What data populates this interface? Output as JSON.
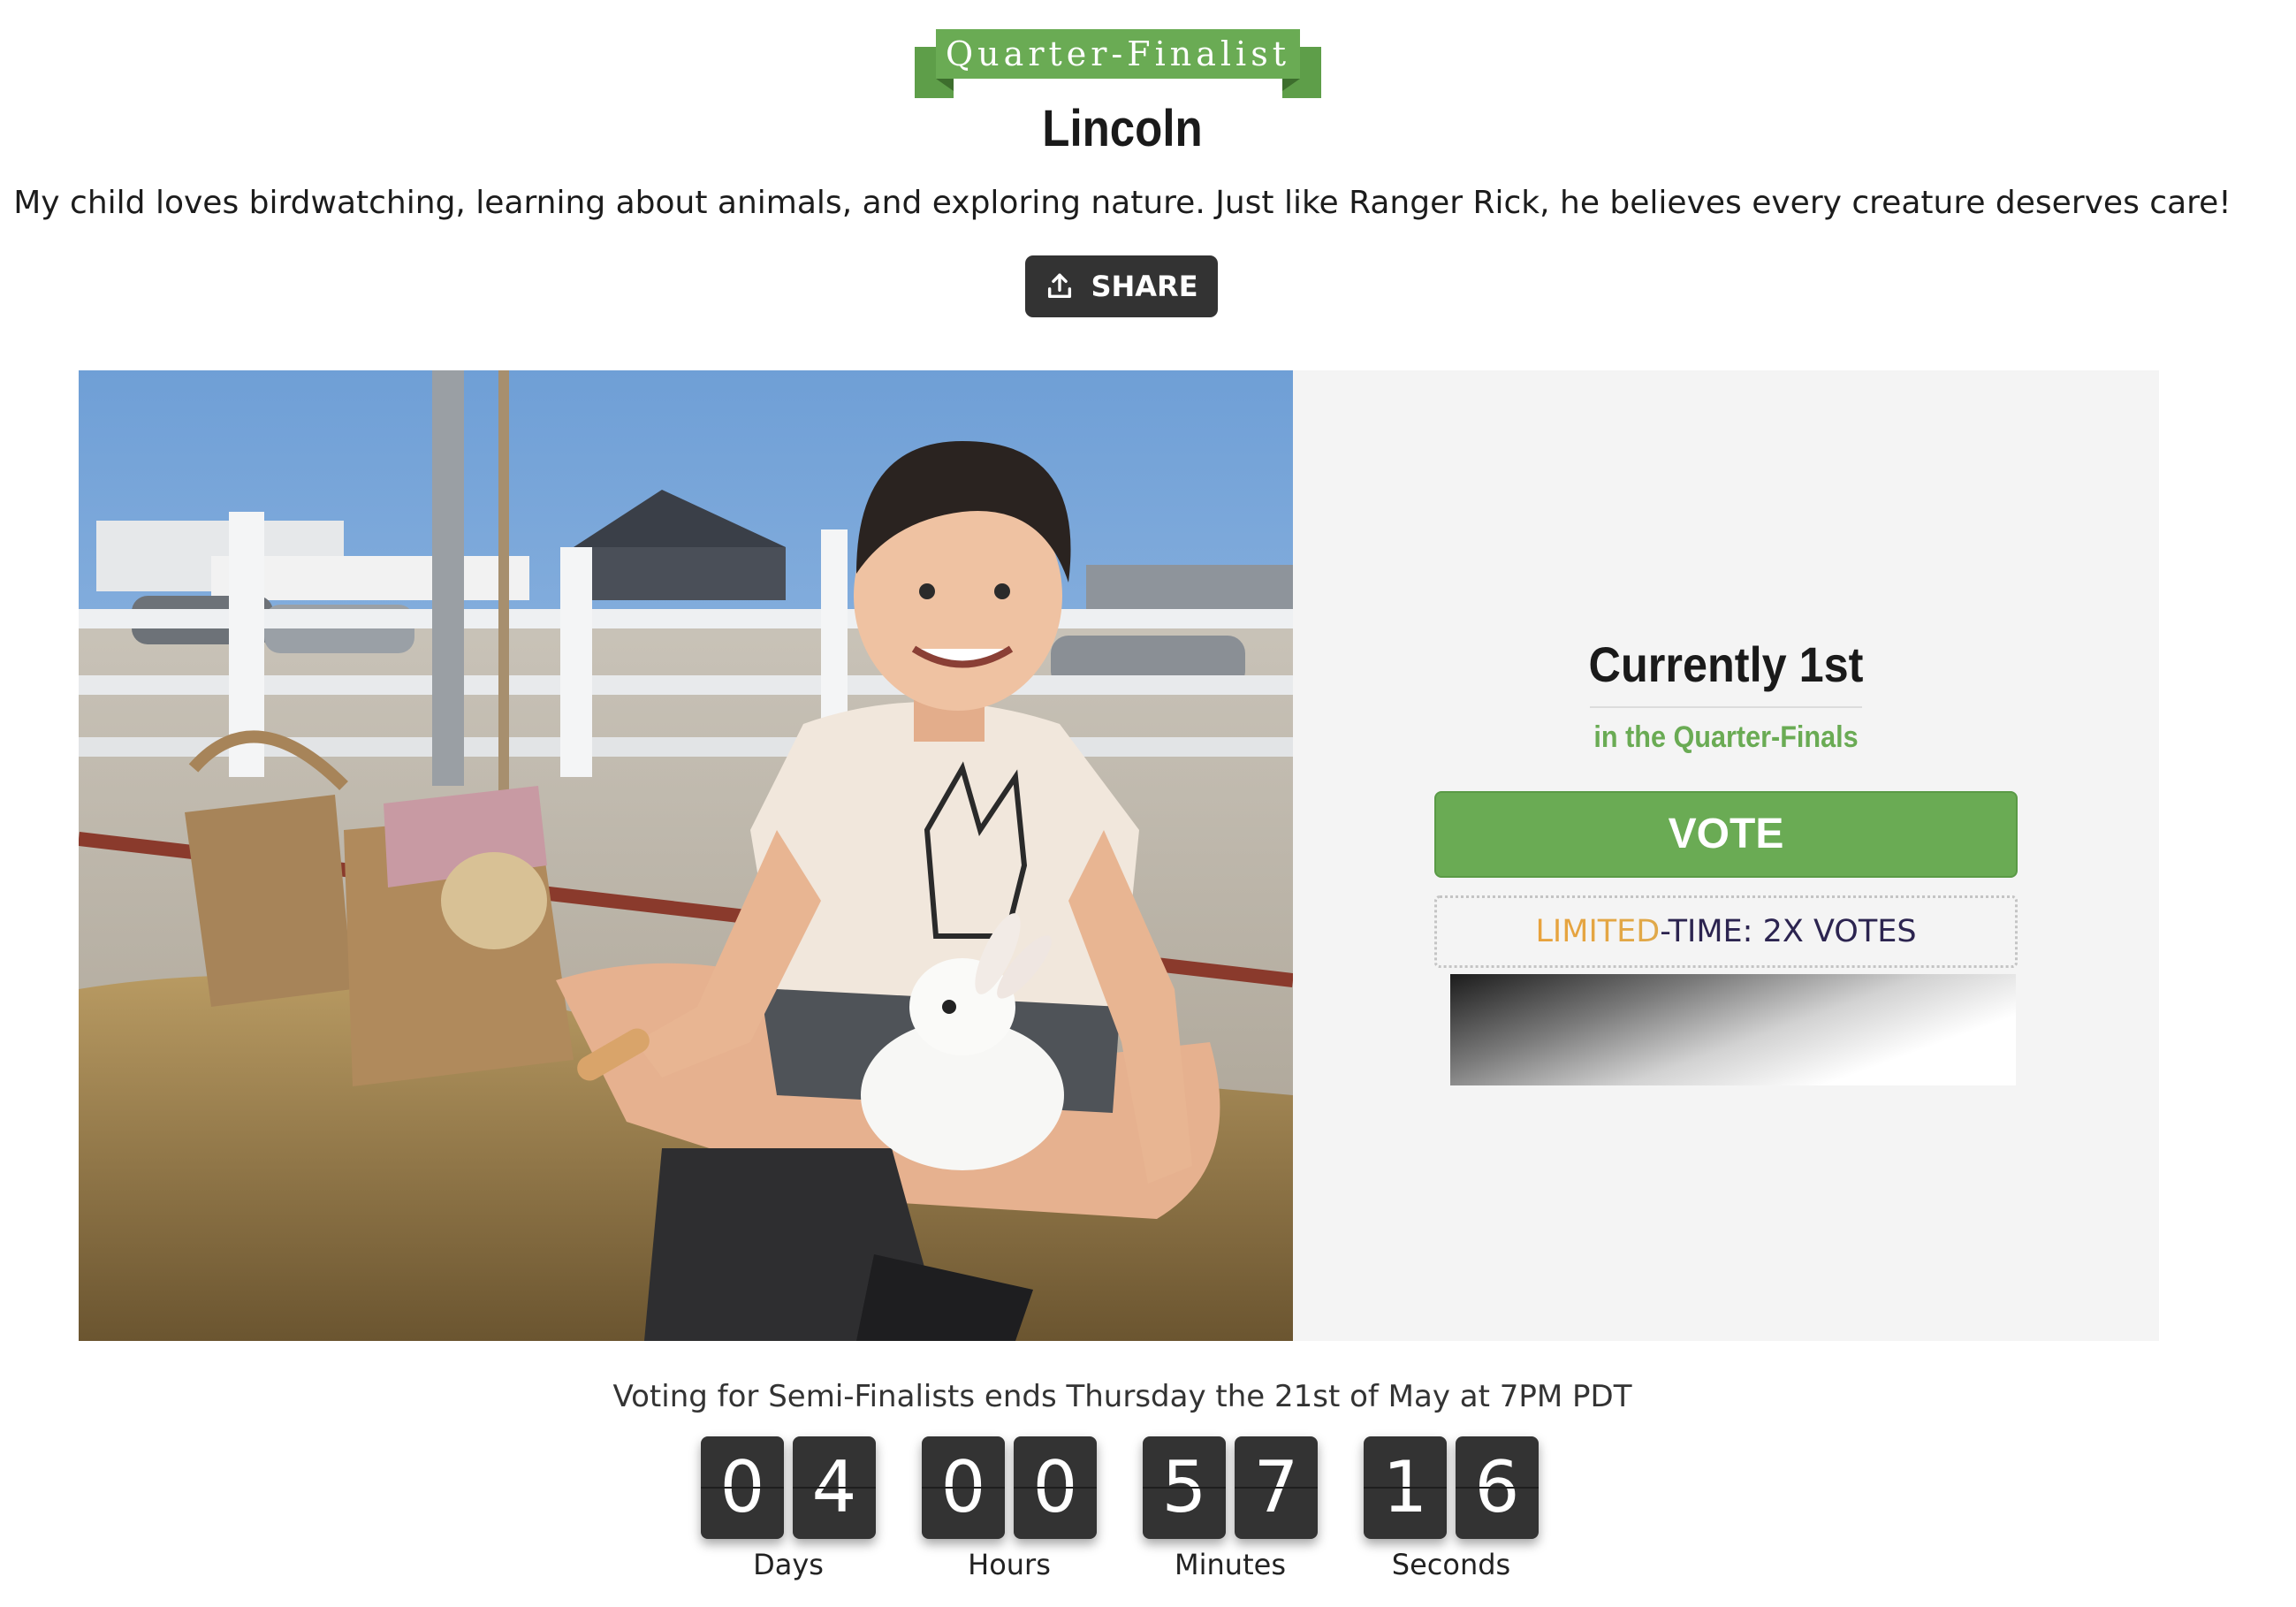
{
  "badge": {
    "label": "Quarter-Finalist"
  },
  "entrant": {
    "name": "Lincoln",
    "description": "My child loves birdwatching, learning about animals, and exploring nature. Just like Ranger Rick, he believes every creature deserves care!",
    "photo_icon": "contestant-photo"
  },
  "share": {
    "label": "SHARE",
    "icon": "share-upload-icon"
  },
  "standing": {
    "rank_text": "Currently 1st",
    "phase_text": "in the Quarter-Finals"
  },
  "vote": {
    "label": "VOTE"
  },
  "promo": {
    "part_warm": "LIMITED",
    "part_cool": "-TIME: 2X VOTES"
  },
  "countdown": {
    "message": "Voting for Semi-Finalists ends Thursday the 21st of May at 7PM PDT",
    "units": [
      {
        "label": "Days",
        "d1": "0",
        "d2": "4"
      },
      {
        "label": "Hours",
        "d1": "0",
        "d2": "0"
      },
      {
        "label": "Minutes",
        "d1": "5",
        "d2": "7"
      },
      {
        "label": "Seconds",
        "d1": "1",
        "d2": "6"
      }
    ]
  },
  "colors": {
    "accent_green": "#6aab54",
    "dark": "#333333",
    "panel_bg": "#f4f4f4",
    "promo_warm": "#e8a23c",
    "promo_cool": "#2c2450"
  }
}
